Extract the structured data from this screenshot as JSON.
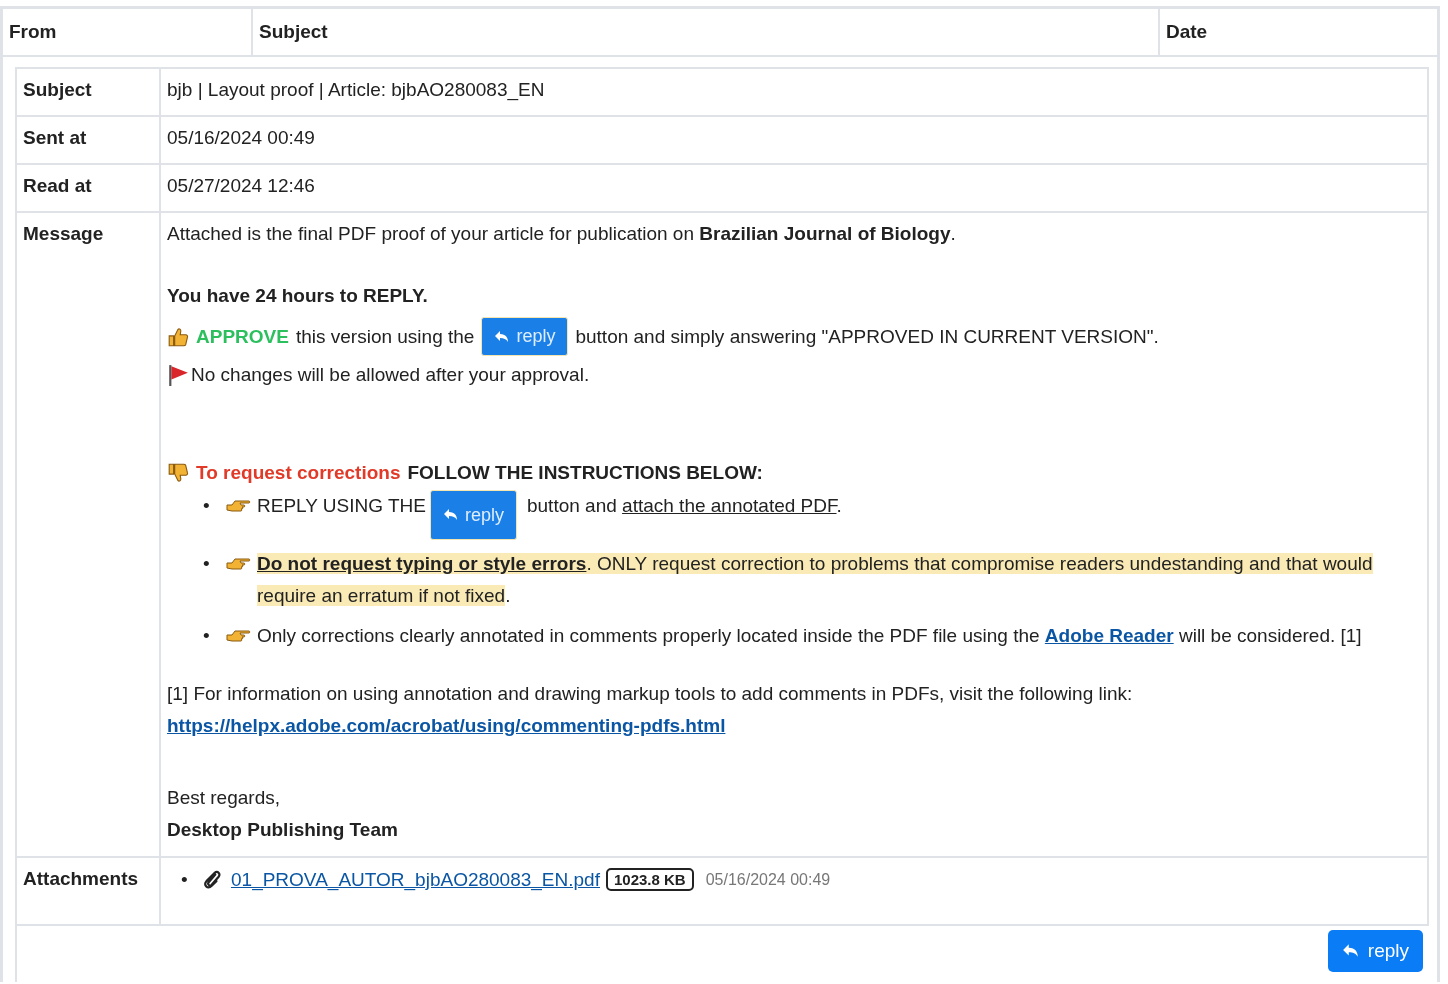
{
  "list_header": {
    "columns": [
      "From",
      "Subject",
      "Date"
    ]
  },
  "details": {
    "rows": [
      {
        "label": "Subject",
        "value": "bjb | Layout proof | Article: bjbAO280083_EN"
      },
      {
        "label": "Sent at",
        "value": "05/16/2024 00:49"
      },
      {
        "label": "Read at",
        "value": "05/27/2024 12:46"
      }
    ],
    "message_label": "Message",
    "message": [
      {
        "kind": "text",
        "text": "Attached is the final PDF proof of your article for publication on **Brazilian Journal of Biology**."
      },
      {
        "kind": "bold",
        "text": "You have 24 hours to REPLY."
      },
      {
        "kind": "approve",
        "highlight": "APPROVE",
        "before": "this version using the",
        "button": "reply",
        "after": "button and simply answering \"APPROVED IN CURRENT VERSION\"."
      },
      {
        "kind": "flag",
        "text": "No changes will be allowed after your approval."
      },
      {
        "kind": "corrections",
        "highlight": "To request corrections",
        "text": "FOLLOW THE INSTRUCTIONS BELOW:"
      },
      {
        "kind": "bullets",
        "marker": "•",
        "items": [
          {
            "kind": "reply",
            "before": "REPLY USING THE",
            "button": "reply",
            "after": "button and",
            "link": "attach the annotated PDF",
            "end": "."
          },
          {
            "kind": "marked",
            "strong": "Do not request typing or style errors",
            "rest": ". ONLY request correction to problems that compromise readers undestanding and that would require an erratum if not fixed",
            "end": "."
          },
          {
            "kind": "link",
            "before": "Only corrections clearly annotated in comments properly located inside the PDF file using the",
            "link": "Adobe Reader",
            "after": "will be considered. [1]"
          }
        ]
      },
      {
        "kind": "footnote",
        "text": "[1] For information on using annotation and drawing markup tools to add comments in PDFs, visit the following link:",
        "link": "https://helpx.adobe.com/acrobat/using/commenting-pdfs.html"
      },
      {
        "kind": "signature",
        "greeting": "Best regards,",
        "team": "Desktop Publishing Team"
      }
    ],
    "attachments_label": "Attachments",
    "attachments_marker": "•",
    "attachments": [
      {
        "name": "01_PROVA_AUTOR_bjbAO280083_EN.pdf",
        "size": "1023.8 KB",
        "date": "05/16/2024 00:49"
      }
    ]
  },
  "reply_button": "reply"
}
